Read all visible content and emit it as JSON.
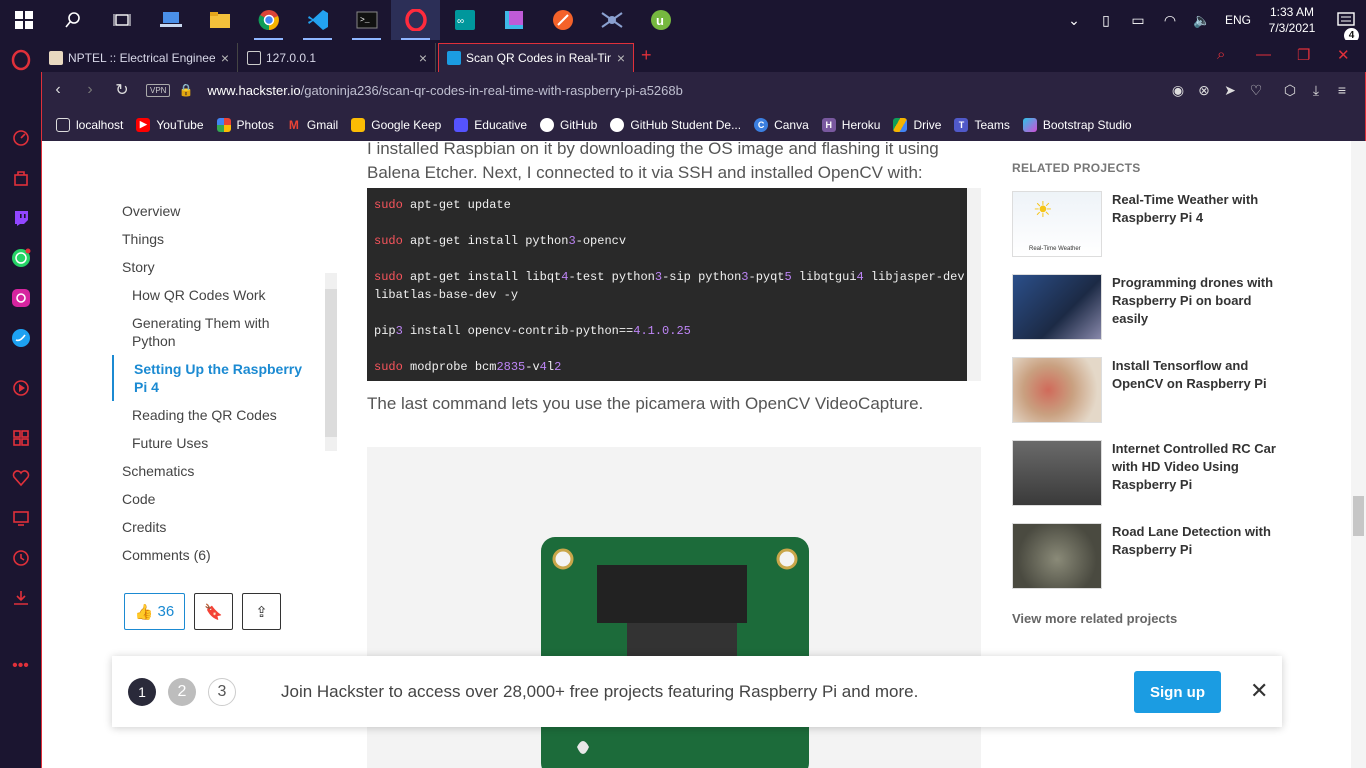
{
  "taskbar": {
    "apps": [
      "search-icon",
      "task-view-icon",
      "laptop-icon",
      "file-explorer-icon",
      "chrome-icon",
      "vscode-icon",
      "terminal-icon",
      "opera-icon",
      "arduino-icon",
      "app-icon",
      "paint-icon",
      "drone-icon",
      "utorrent-icon"
    ],
    "time": "1:33 AM",
    "date": "7/3/2021",
    "lang": "ENG",
    "notifications": "4"
  },
  "tabs": [
    {
      "title": "NPTEL :: Electrical Engineering",
      "active": false
    },
    {
      "title": "127.0.0.1",
      "active": false
    },
    {
      "title": "Scan QR Codes in Real-Time",
      "active": true
    }
  ],
  "address": {
    "vpn": "VPN",
    "domain": "www.hackster.io",
    "path": "/gatoninja236/scan-qr-codes-in-real-time-with-raspberry-pi-a5268b"
  },
  "bookmarks": [
    "localhost",
    "YouTube",
    "Photos",
    "Gmail",
    "Google Keep",
    "Educative",
    "GitHub",
    "GitHub Student De...",
    "Canva",
    "Heroku",
    "Drive",
    "Teams",
    "Bootstrap Studio"
  ],
  "toc": {
    "items": [
      "Overview",
      "Things",
      "Story"
    ],
    "story_items": [
      "How QR Codes Work",
      "Generating Them with Python",
      "Setting Up the Raspberry Pi 4",
      "Reading the QR Codes",
      "Future Uses"
    ],
    "after_items": [
      "Schematics",
      "Code",
      "Credits",
      "Comments (6)"
    ]
  },
  "respect": {
    "count": "36"
  },
  "article": {
    "top_text": "I installed Raspbian on it by downloading the OS image and flashing it using Balena Etcher. Next, I connected to it via SSH and installed OpenCV with:",
    "code": {
      "line1": "apt-get update",
      "line2": "sudo apt-get install python3-opencv",
      "line3": "sudo apt-get install libqt4-test python3-sip python3-pyqt5 libqtgui4 libjasper-dev",
      "line4": "libatlas-base-dev -y",
      "line5": "pip3 install opencv-contrib-python==4.1.0.25",
      "line6": "sudo modprobe bcm2835-v4l2"
    },
    "caption": "The last command lets you use the picamera with OpenCV VideoCapture."
  },
  "related": {
    "heading": "RELATED PROJECTS",
    "items": [
      {
        "title": "Real-Time Weather with Raspberry Pi 4",
        "thumb_label": "Real-Time Weather"
      },
      {
        "title": "Programming drones with Raspberry Pi on board easily"
      },
      {
        "title": "Install Tensorflow and OpenCV on Raspberry Pi"
      },
      {
        "title": "Internet Controlled RC Car with HD Video Using Raspberry Pi"
      },
      {
        "title": "Road Lane Detection with Raspberry Pi"
      }
    ],
    "more": "View more related projects"
  },
  "banner": {
    "steps": [
      "1",
      "2",
      "3"
    ],
    "text": "Join Hackster to access over 28,000+ free projects featuring Raspberry Pi and more.",
    "signup": "Sign up"
  },
  "colors": {
    "accent": "#e0303a",
    "link": "#1b8ad2",
    "signup": "#1b9ce2",
    "chrome": "#1b1530"
  }
}
